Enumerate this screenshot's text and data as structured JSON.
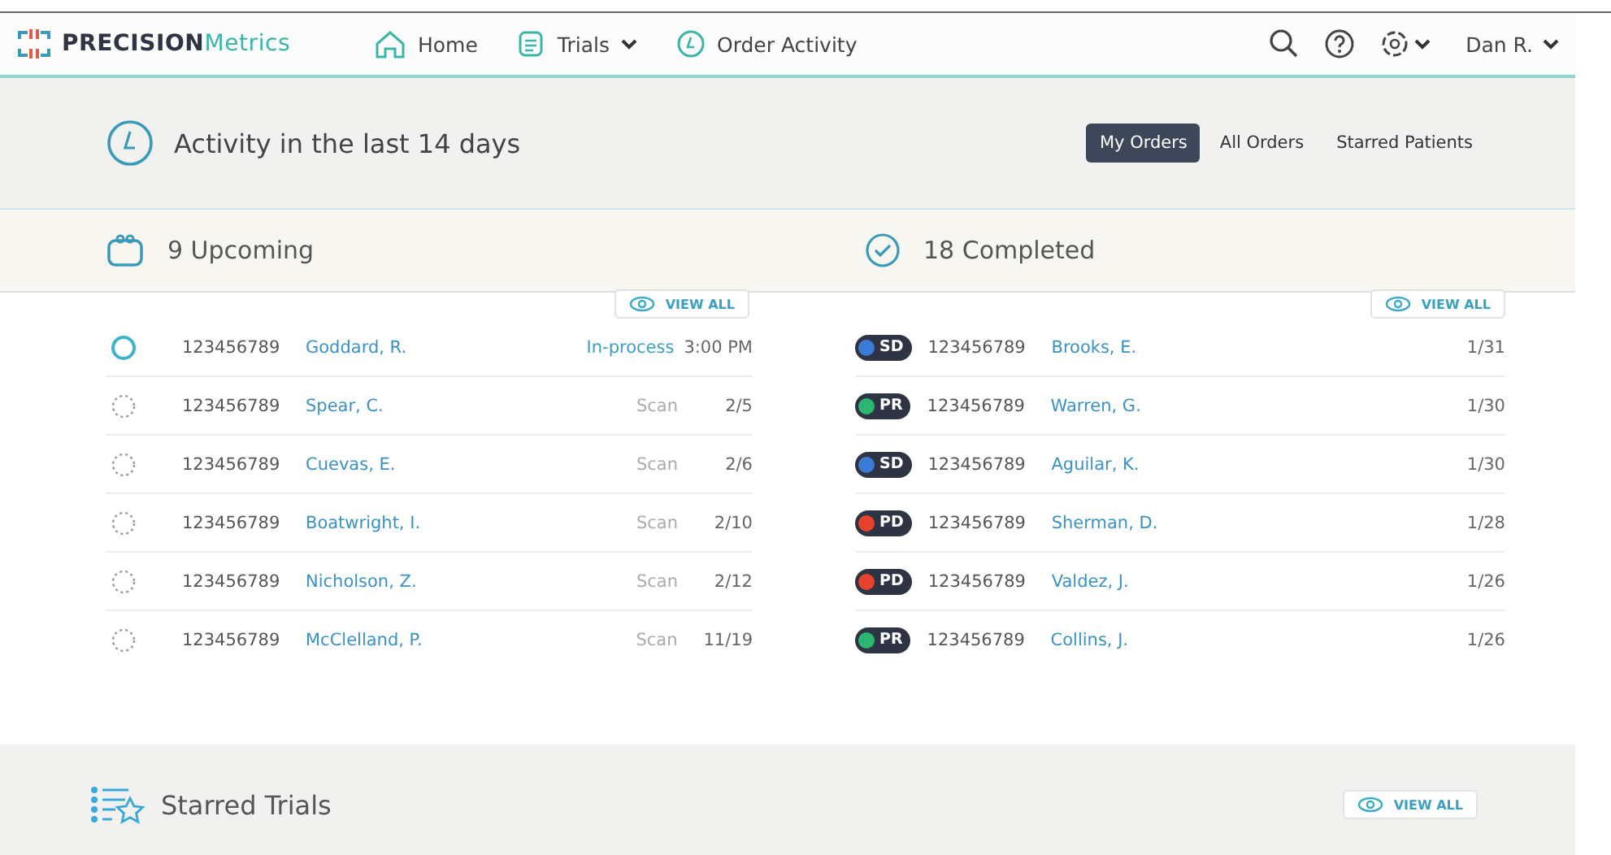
{
  "brand": {
    "bold": "PRECISION",
    "light": "Metrics"
  },
  "nav": [
    {
      "label": "Home",
      "kind": "home",
      "dropdown": false
    },
    {
      "label": "Trials",
      "kind": "trials",
      "dropdown": true
    },
    {
      "label": "Order Activity",
      "kind": "activity",
      "dropdown": false
    }
  ],
  "user": {
    "name": "Dan R."
  },
  "activity": {
    "title": "Activity in the last 14 days",
    "filters": [
      {
        "label": "My Orders",
        "selected": true
      },
      {
        "label": "All Orders",
        "selected": false
      },
      {
        "label": "Starred Patients",
        "selected": false
      }
    ]
  },
  "upcoming": {
    "title": "9 Upcoming",
    "view_all": "VIEW ALL",
    "rows": [
      {
        "kind": "active",
        "id": "123456789",
        "name": "Goddard, R.",
        "status": "In-process",
        "date": "3:00 PM"
      },
      {
        "kind": "pending",
        "id": "123456789",
        "name": "Spear, C.",
        "status": "Scan",
        "date": "2/5"
      },
      {
        "kind": "pending",
        "id": "123456789",
        "name": "Cuevas, E.",
        "status": "Scan",
        "date": "2/6"
      },
      {
        "kind": "pending",
        "id": "123456789",
        "name": "Boatwright, I.",
        "status": "Scan",
        "date": "2/10"
      },
      {
        "kind": "pending",
        "id": "123456789",
        "name": "Nicholson, Z.",
        "status": "Scan",
        "date": "2/12"
      },
      {
        "kind": "pending",
        "id": "123456789",
        "name": "McClelland, P.",
        "status": "Scan",
        "date": "11/19"
      }
    ]
  },
  "completed": {
    "title": "18 Completed",
    "view_all": "VIEW ALL",
    "rows": [
      {
        "code": "SD",
        "color": "#3a7bd5",
        "id": "123456789",
        "name": "Brooks, E.",
        "date": "1/31"
      },
      {
        "code": "PR",
        "color": "#2bb673",
        "id": "123456789",
        "name": "Warren, G.",
        "date": "1/30"
      },
      {
        "code": "SD",
        "color": "#3a7bd5",
        "id": "123456789",
        "name": "Aguilar, K.",
        "date": "1/30"
      },
      {
        "code": "PD",
        "color": "#e8412c",
        "id": "123456789",
        "name": "Sherman, D.",
        "date": "1/28"
      },
      {
        "code": "PD",
        "color": "#e8412c",
        "id": "123456789",
        "name": "Valdez, J.",
        "date": "1/26"
      },
      {
        "code": "PR",
        "color": "#2bb673",
        "id": "123456789",
        "name": "Collins, J.",
        "date": "1/26"
      }
    ]
  },
  "starred": {
    "title": "Starred Trials",
    "view_all": "VIEW ALL"
  }
}
